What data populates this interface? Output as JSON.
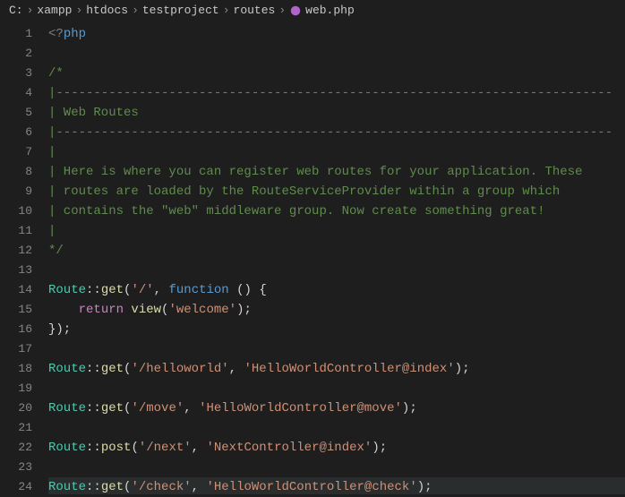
{
  "breadcrumb": {
    "items": [
      "C:",
      "xampp",
      "htdocs",
      "testproject",
      "routes"
    ],
    "file": "web.php",
    "fileIcon": "elephant-php-icon"
  },
  "editor": {
    "highlightLine": 24,
    "lines": [
      {
        "n": 1,
        "ind": 0,
        "tokens": [
          [
            "tag",
            "<?"
          ],
          [
            "key",
            "php"
          ]
        ]
      },
      {
        "n": 2,
        "ind": 0,
        "tokens": []
      },
      {
        "n": 3,
        "ind": 0,
        "tokens": [
          [
            "comment",
            "/*"
          ]
        ]
      },
      {
        "n": 4,
        "ind": 0,
        "tokens": [
          [
            "comment",
            "|--------------------------------------------------------------------------"
          ]
        ]
      },
      {
        "n": 5,
        "ind": 0,
        "tokens": [
          [
            "comment",
            "| Web Routes"
          ]
        ]
      },
      {
        "n": 6,
        "ind": 0,
        "tokens": [
          [
            "comment",
            "|--------------------------------------------------------------------------"
          ]
        ]
      },
      {
        "n": 7,
        "ind": 0,
        "tokens": [
          [
            "comment",
            "|"
          ]
        ]
      },
      {
        "n": 8,
        "ind": 0,
        "tokens": [
          [
            "comment",
            "| Here is where you can register web routes for your application. These"
          ]
        ]
      },
      {
        "n": 9,
        "ind": 0,
        "tokens": [
          [
            "comment",
            "| routes are loaded by the RouteServiceProvider within a group which"
          ]
        ]
      },
      {
        "n": 10,
        "ind": 0,
        "tokens": [
          [
            "comment",
            "| contains the \"web\" middleware group. Now create something great!"
          ]
        ]
      },
      {
        "n": 11,
        "ind": 0,
        "tokens": [
          [
            "comment",
            "|"
          ]
        ]
      },
      {
        "n": 12,
        "ind": 0,
        "tokens": [
          [
            "comment",
            "*/"
          ]
        ]
      },
      {
        "n": 13,
        "ind": 0,
        "tokens": []
      },
      {
        "n": 14,
        "ind": 0,
        "tokens": [
          [
            "class",
            "Route"
          ],
          [
            "op",
            "::"
          ],
          [
            "func",
            "get"
          ],
          [
            "punct",
            "("
          ],
          [
            "string",
            "'/'"
          ],
          [
            "punct",
            ", "
          ],
          [
            "key",
            "function "
          ],
          [
            "punct",
            "() {"
          ]
        ]
      },
      {
        "n": 15,
        "ind": 1,
        "tokens": [
          [
            "kw",
            "return "
          ],
          [
            "func",
            "view"
          ],
          [
            "punct",
            "("
          ],
          [
            "string",
            "'welcome'"
          ],
          [
            "punct",
            ");"
          ]
        ]
      },
      {
        "n": 16,
        "ind": 0,
        "tokens": [
          [
            "punct",
            "});"
          ]
        ]
      },
      {
        "n": 17,
        "ind": 0,
        "tokens": []
      },
      {
        "n": 18,
        "ind": 0,
        "tokens": [
          [
            "class",
            "Route"
          ],
          [
            "op",
            "::"
          ],
          [
            "func",
            "get"
          ],
          [
            "punct",
            "("
          ],
          [
            "string",
            "'/helloworld'"
          ],
          [
            "punct",
            ", "
          ],
          [
            "string",
            "'HelloWorldController@index'"
          ],
          [
            "punct",
            ");"
          ]
        ]
      },
      {
        "n": 19,
        "ind": 0,
        "tokens": []
      },
      {
        "n": 20,
        "ind": 0,
        "tokens": [
          [
            "class",
            "Route"
          ],
          [
            "op",
            "::"
          ],
          [
            "func",
            "get"
          ],
          [
            "punct",
            "("
          ],
          [
            "string",
            "'/move'"
          ],
          [
            "punct",
            ", "
          ],
          [
            "string",
            "'HelloWorldController@move'"
          ],
          [
            "punct",
            ");"
          ]
        ]
      },
      {
        "n": 21,
        "ind": 0,
        "tokens": []
      },
      {
        "n": 22,
        "ind": 0,
        "tokens": [
          [
            "class",
            "Route"
          ],
          [
            "op",
            "::"
          ],
          [
            "func",
            "post"
          ],
          [
            "punct",
            "("
          ],
          [
            "string",
            "'/next'"
          ],
          [
            "punct",
            ", "
          ],
          [
            "string",
            "'NextController@index'"
          ],
          [
            "punct",
            ");"
          ]
        ]
      },
      {
        "n": 23,
        "ind": 0,
        "tokens": []
      },
      {
        "n": 24,
        "ind": 0,
        "tokens": [
          [
            "class",
            "Route"
          ],
          [
            "op",
            "::"
          ],
          [
            "func",
            "get"
          ],
          [
            "punct",
            "("
          ],
          [
            "string",
            "'/check'"
          ],
          [
            "punct",
            ", "
          ],
          [
            "string",
            "'HelloWorldController@check'"
          ],
          [
            "punct",
            ");"
          ]
        ]
      }
    ]
  }
}
